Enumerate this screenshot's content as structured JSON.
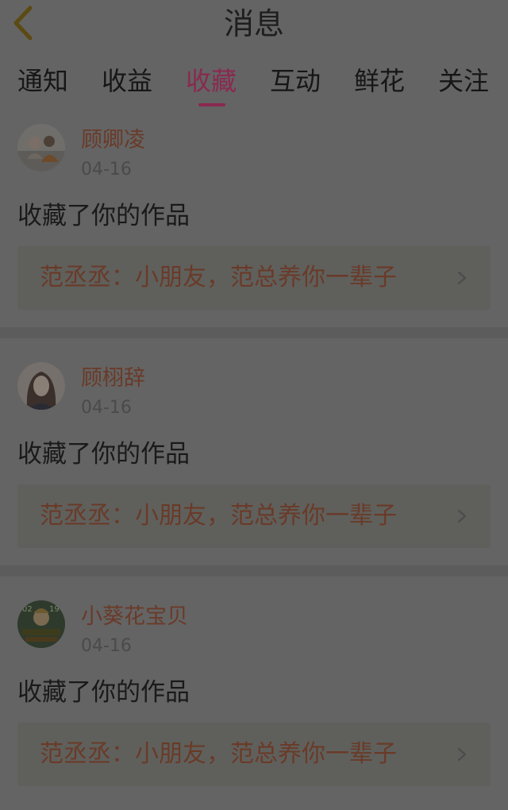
{
  "header": {
    "title": "消息",
    "back_icon": "chevron-left-icon"
  },
  "tabs": [
    {
      "label": "通知",
      "active": false
    },
    {
      "label": "收益",
      "active": false
    },
    {
      "label": "收藏",
      "active": true
    },
    {
      "label": "互动",
      "active": false
    },
    {
      "label": "鲜花",
      "active": false
    },
    {
      "label": "关注",
      "active": false
    }
  ],
  "colors": {
    "accent": "#8a2950",
    "name": "#6a3a28",
    "background": "#646464"
  },
  "messages": [
    {
      "user": "顾卿凌",
      "date": "04-16",
      "action": "收藏了你的作品",
      "work": "范丞丞：小朋友，范总养你一辈子"
    },
    {
      "user": "顾栩辞",
      "date": "04-16",
      "action": "收藏了你的作品",
      "work": "范丞丞：小朋友，范总养你一辈子"
    },
    {
      "user": "小葵花宝贝",
      "date": "04-16",
      "action": "收藏了你的作品",
      "work": "范丞丞：小朋友，范总养你一辈子"
    }
  ]
}
